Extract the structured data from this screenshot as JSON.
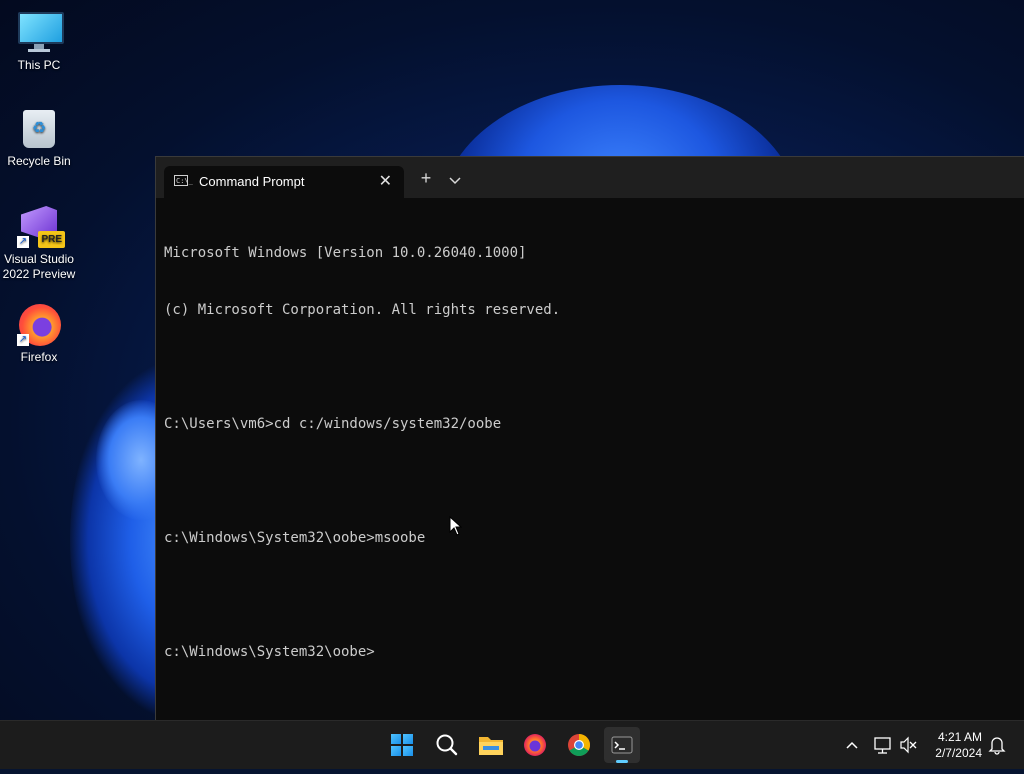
{
  "desktop": {
    "icons": [
      {
        "label": "This PC"
      },
      {
        "label": "Recycle Bin"
      },
      {
        "label": "Visual Studio 2022 Preview",
        "badge": "PRE"
      },
      {
        "label": "Firefox"
      }
    ]
  },
  "terminal": {
    "tab_title": "Command Prompt",
    "tab_icon_text": "C:\\_",
    "new_tab_label": "+",
    "dropdown_label": "⌄",
    "close_label": "✕",
    "lines": [
      "Microsoft Windows [Version 10.0.26040.1000]",
      "(c) Microsoft Corporation. All rights reserved.",
      "",
      "C:\\Users\\vm6>cd c:/windows/system32/oobe",
      "",
      "c:\\Windows\\System32\\oobe>msoobe",
      "",
      "c:\\Windows\\System32\\oobe>"
    ]
  },
  "taskbar": {
    "apps": [
      {
        "name": "start",
        "icon": "windows-logo-icon"
      },
      {
        "name": "search",
        "icon": "search-icon"
      },
      {
        "name": "file-explorer",
        "icon": "folder-icon"
      },
      {
        "name": "firefox",
        "icon": "firefox-icon"
      },
      {
        "name": "chrome",
        "icon": "chrome-icon"
      },
      {
        "name": "terminal",
        "icon": "terminal-icon",
        "active": true
      }
    ],
    "tray": {
      "chevron": "^",
      "time": "4:21 AM",
      "date": "2/7/2024"
    }
  },
  "colors": {
    "accent": "#60cdff",
    "console_text": "#cccccc",
    "console_bg": "#0c0c0c",
    "taskbar_bg": "#1c1c1c"
  }
}
